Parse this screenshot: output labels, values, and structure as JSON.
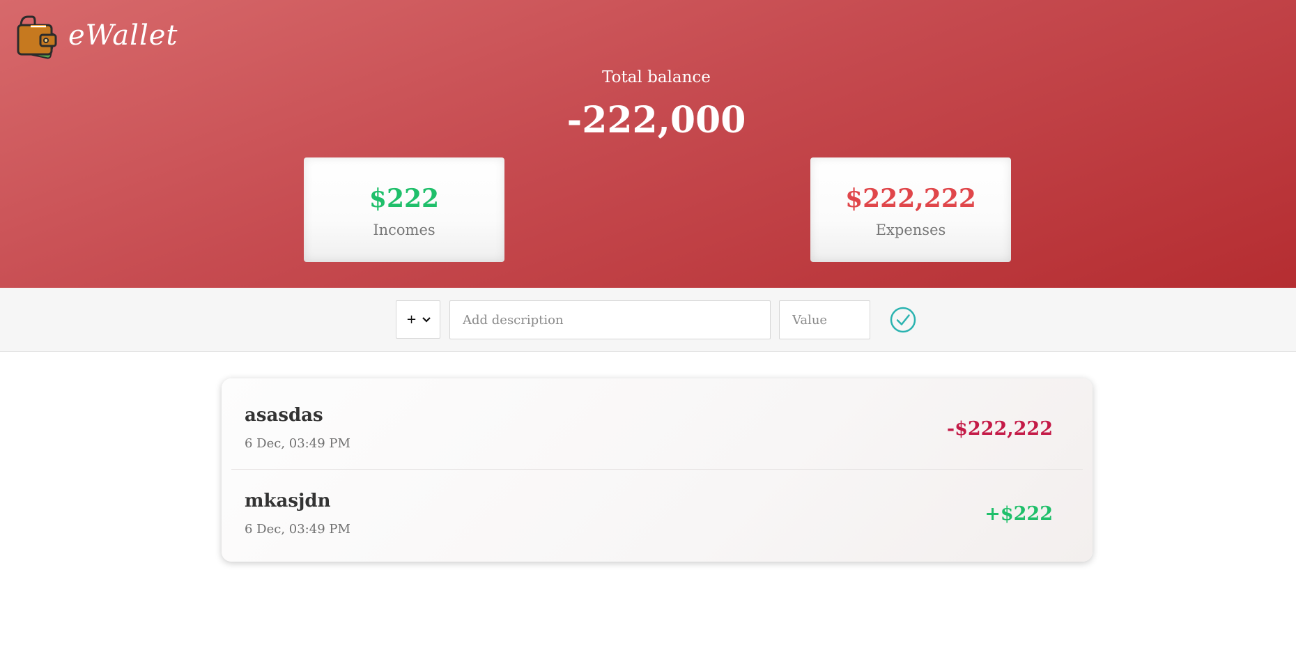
{
  "app": {
    "brand": "eWallet",
    "logo_icon": "wallet-icon"
  },
  "balance": {
    "label": "Total balance",
    "value": "-222,000"
  },
  "summary": {
    "incomes": {
      "amount": "$222",
      "label": "Incomes",
      "color": "#1fbf6a"
    },
    "expenses": {
      "amount": "$222,222",
      "label": "Expenses",
      "color": "#e0464a"
    }
  },
  "form": {
    "type_selected": "+",
    "description_placeholder": "Add description",
    "value_placeholder": "Value",
    "submit_icon": "check-circle-icon",
    "accent_color": "#2ab3b0"
  },
  "transactions": [
    {
      "description": "asasdas",
      "time": "6 Dec, 03:49 PM",
      "amount": "-$222,222",
      "type": "expense",
      "color": "#c41a47"
    },
    {
      "description": "mkasjdn",
      "time": "6 Dec, 03:49 PM",
      "amount": "+$222",
      "type": "income",
      "color": "#1fbf6a"
    }
  ],
  "colors": {
    "header_start": "#d7696b",
    "header_end": "#b52d31"
  }
}
